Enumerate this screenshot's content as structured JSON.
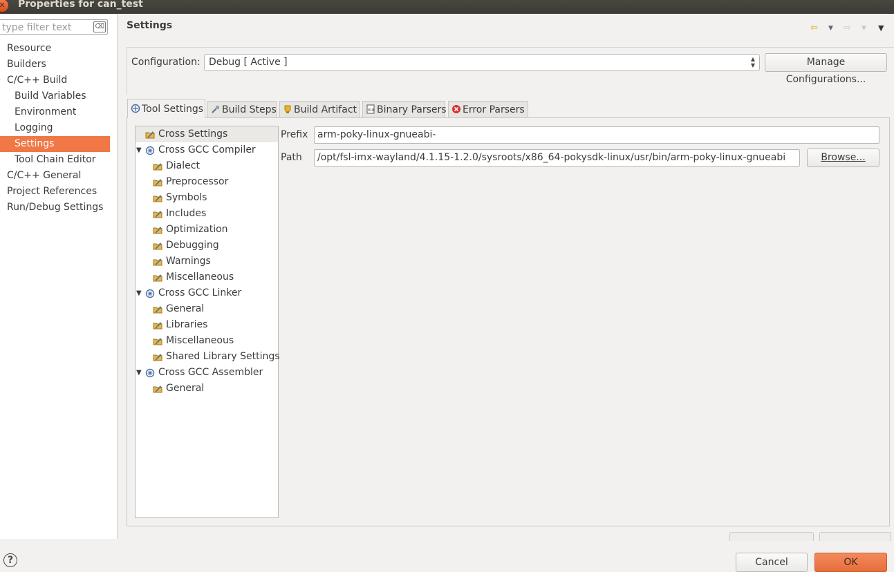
{
  "window": {
    "title": "Properties for can_test"
  },
  "sidebar": {
    "filter_placeholder": "type filter text",
    "items": [
      {
        "label": "Resource",
        "level": 0
      },
      {
        "label": "Builders",
        "level": 0
      },
      {
        "label": "C/C++ Build",
        "level": 0,
        "expanded": true
      },
      {
        "label": "Build Variables",
        "level": 1
      },
      {
        "label": "Environment",
        "level": 1
      },
      {
        "label": "Logging",
        "level": 1
      },
      {
        "label": "Settings",
        "level": 1,
        "selected": true
      },
      {
        "label": "Tool Chain Editor",
        "level": 1
      },
      {
        "label": "C/C++ General",
        "level": 0
      },
      {
        "label": "Project References",
        "level": 0
      },
      {
        "label": "Run/Debug Settings",
        "level": 0
      }
    ]
  },
  "header": {
    "title": "Settings"
  },
  "config": {
    "label": "Configuration:",
    "value": "Debug  [ Active ]",
    "manage_label": "Manage Configurations..."
  },
  "tabs": [
    {
      "label": "Tool Settings",
      "icon": "tool-settings-icon",
      "active": true
    },
    {
      "label": "Build Steps",
      "icon": "build-steps-icon"
    },
    {
      "label": "Build Artifact",
      "icon": "build-artifact-icon"
    },
    {
      "label": "Binary Parsers",
      "icon": "binary-parsers-icon"
    },
    {
      "label": "Error Parsers",
      "icon": "error-parsers-icon"
    }
  ],
  "tool_tree": [
    {
      "label": "Cross Settings",
      "level": 0,
      "kind": "option",
      "selected": true
    },
    {
      "label": "Cross GCC Compiler",
      "level": 0,
      "kind": "tool",
      "expanded": true
    },
    {
      "label": "Dialect",
      "level": 1,
      "kind": "option"
    },
    {
      "label": "Preprocessor",
      "level": 1,
      "kind": "option"
    },
    {
      "label": "Symbols",
      "level": 1,
      "kind": "option"
    },
    {
      "label": "Includes",
      "level": 1,
      "kind": "option"
    },
    {
      "label": "Optimization",
      "level": 1,
      "kind": "option"
    },
    {
      "label": "Debugging",
      "level": 1,
      "kind": "option"
    },
    {
      "label": "Warnings",
      "level": 1,
      "kind": "option"
    },
    {
      "label": "Miscellaneous",
      "level": 1,
      "kind": "option"
    },
    {
      "label": "Cross GCC Linker",
      "level": 0,
      "kind": "tool",
      "expanded": true
    },
    {
      "label": "General",
      "level": 1,
      "kind": "option"
    },
    {
      "label": "Libraries",
      "level": 1,
      "kind": "option"
    },
    {
      "label": "Miscellaneous",
      "level": 1,
      "kind": "option"
    },
    {
      "label": "Shared Library Settings",
      "level": 1,
      "kind": "option"
    },
    {
      "label": "Cross GCC Assembler",
      "level": 0,
      "kind": "tool",
      "expanded": true
    },
    {
      "label": "General",
      "level": 1,
      "kind": "option"
    }
  ],
  "cross_settings": {
    "prefix_label": "Prefix",
    "prefix_value": "arm-poky-linux-gnueabi-",
    "path_label": "Path",
    "path_value": "/opt/fsl-imx-wayland/4.1.15-1.2.0/sysroots/x86_64-pokysdk-linux/usr/bin/arm-poky-linux-gnueabi",
    "browse_label": "Browse..."
  },
  "footer": {
    "help": "?",
    "cancel_label": "Cancel",
    "ok_label": "OK"
  },
  "colors": {
    "selection": "#f07746",
    "ok_button": "#ed7a48",
    "title_bar": "#3c3b37"
  }
}
